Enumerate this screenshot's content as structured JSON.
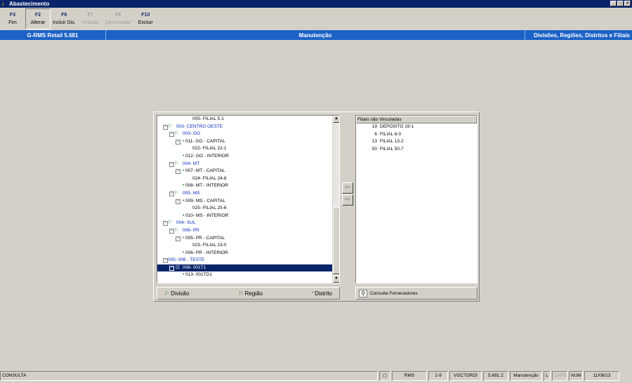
{
  "window": {
    "title": "Abastecimento",
    "controls": [
      "_",
      "□",
      "×"
    ]
  },
  "toolbar": [
    {
      "key": "F3",
      "label": "Fim",
      "enabled": true,
      "pressed": false
    },
    {
      "key": "F2",
      "label": "Alterar",
      "enabled": true,
      "pressed": true
    },
    {
      "key": "F6",
      "label": "Incluir Dis.",
      "enabled": true,
      "pressed": false
    },
    {
      "key": "F7",
      "label": "Vincular",
      "enabled": false,
      "pressed": false
    },
    {
      "key": "F8",
      "label": "Desvincular",
      "enabled": false,
      "pressed": false
    },
    {
      "key": "F10",
      "label": "Excluir",
      "enabled": true,
      "pressed": false
    }
  ],
  "header": {
    "left": "G-RMS Retail 5.681",
    "center": "Manutenção",
    "right": "Divisões, Regiões, Distritos e Filiais"
  },
  "tree": {
    "rows": [
      {
        "text": "005- FILIAL 5-1",
        "level": 5,
        "type": "filial",
        "color": "black",
        "selected": false
      },
      {
        "text": "003- CENTRO OESTE",
        "level": 0,
        "type": "divisao",
        "color": "blue",
        "selected": false
      },
      {
        "text": "003- GO",
        "level": 1,
        "type": "regiao",
        "color": "blue",
        "selected": false
      },
      {
        "text": "011- GO - CAPITAL",
        "level": 2,
        "type": "distrito",
        "color": "black",
        "selected": false
      },
      {
        "text": "022- FILIAL 22-1",
        "level": 4,
        "type": "filial",
        "color": "black",
        "selected": false
      },
      {
        "text": "012- GO - INTERIOR",
        "level": 3,
        "type": "distrito-leaf",
        "color": "black",
        "selected": false
      },
      {
        "text": "004- MT",
        "level": 1,
        "type": "regiao",
        "color": "blue",
        "selected": false
      },
      {
        "text": "007- MT - CAPITAL",
        "level": 2,
        "type": "distrito",
        "color": "black",
        "selected": false
      },
      {
        "text": "024- FILIAL 24-8",
        "level": 4,
        "type": "filial",
        "color": "black",
        "selected": false
      },
      {
        "text": "008- MT - INTERIOR",
        "level": 3,
        "type": "distrito-leaf",
        "color": "black",
        "selected": false
      },
      {
        "text": "005- MS",
        "level": 1,
        "type": "regiao",
        "color": "blue",
        "selected": false
      },
      {
        "text": "009- MS - CAPITAL",
        "level": 2,
        "type": "distrito",
        "color": "black",
        "selected": false
      },
      {
        "text": "025- FILIAL 25-6",
        "level": 4,
        "type": "filial",
        "color": "black",
        "selected": false
      },
      {
        "text": "010- MS - INTERIOR",
        "level": 3,
        "type": "distrito-leaf",
        "color": "black",
        "selected": false
      },
      {
        "text": "004- SUL",
        "level": 0,
        "type": "divisao",
        "color": "blue",
        "selected": false
      },
      {
        "text": "006- PR",
        "level": 1,
        "type": "regiao",
        "color": "blue",
        "selected": false
      },
      {
        "text": "005- PR - CAPITAL",
        "level": 2,
        "type": "distrito",
        "color": "black",
        "selected": false
      },
      {
        "text": "023- FILIAL 23-0",
        "level": 4,
        "type": "filial",
        "color": "black",
        "selected": false
      },
      {
        "text": "006- PR - INTERIOR",
        "level": 3,
        "type": "distrito-leaf",
        "color": "black",
        "selected": false
      },
      {
        "text": "005- 006 - TESTE",
        "level": 0,
        "type": "divisao-plain",
        "color": "blue",
        "selected": false
      },
      {
        "text": "008- 001T1",
        "level": 1,
        "type": "regiao-selected",
        "color": "white",
        "selected": true
      },
      {
        "text": "013- 001TD1",
        "level": 3,
        "type": "distrito-leaf",
        "color": "black",
        "selected": false
      }
    ]
  },
  "filiais": {
    "header": "Filiais não Vinculadas",
    "rows": [
      {
        "num": "19",
        "name": "DEPOSITO 19-1"
      },
      {
        "num": "6",
        "name": "FILIAL 6-0"
      },
      {
        "num": "13",
        "name": "FILIAL 13-2"
      },
      {
        "num": "50",
        "name": "FILIAL 50-7"
      }
    ]
  },
  "buttons": {
    "divisao": "Divisão",
    "regiao": "Região",
    "distrito": "Distrito",
    "consulta": "Consulta Fornecedores",
    "move_left": "⇦",
    "move_right": "⇨"
  },
  "statusbar": {
    "mode": "CONSULTA",
    "system": "RMS",
    "range": "1-9",
    "program": "VGCTDRDI",
    "version": "5.681.2",
    "screen": "Manutenção",
    "l": "L",
    "caps": "CAPS",
    "num": "NUM",
    "date": "11/06/13"
  }
}
